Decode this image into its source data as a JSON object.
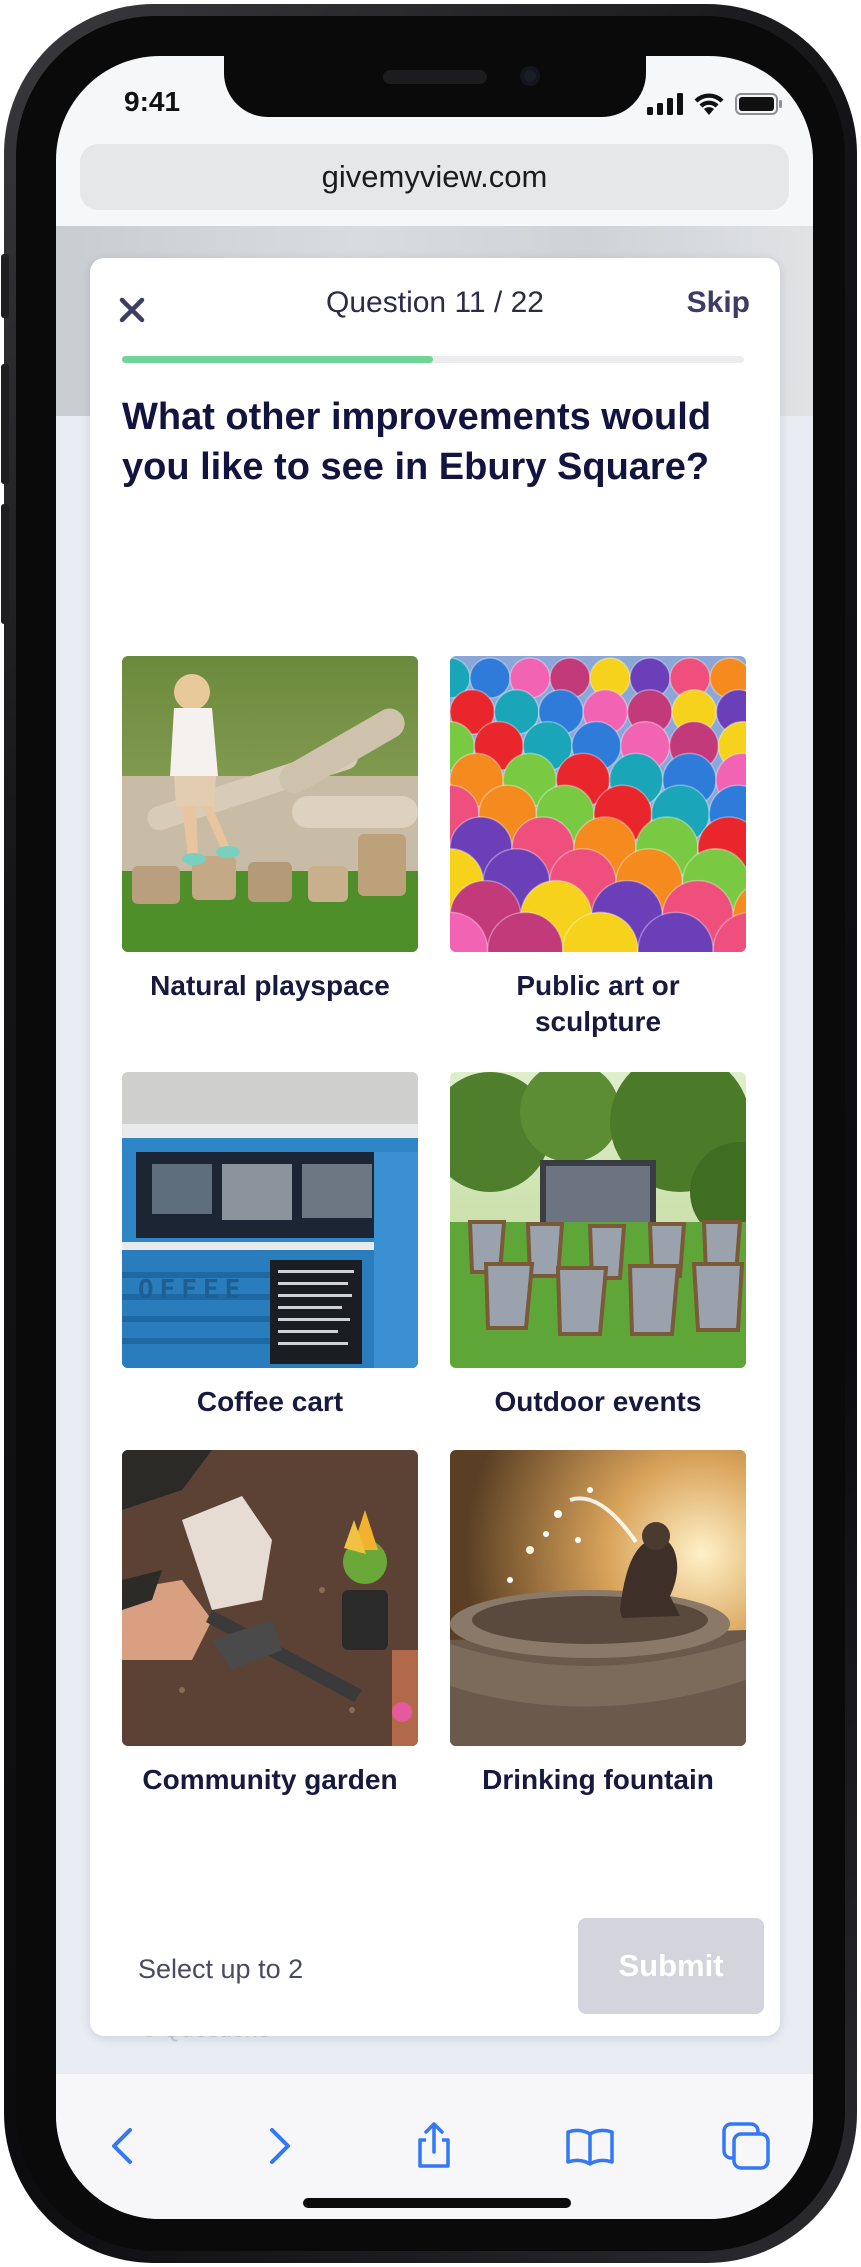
{
  "status_bar": {
    "time": "9:41"
  },
  "browser": {
    "url": "givemyview.com"
  },
  "survey": {
    "question_counter": "Question 11 / 22",
    "skip_label": "Skip",
    "progress": 0.5,
    "question": "What other improvements would you like to see in Ebury Square?",
    "options": [
      {
        "label": "Natural playspace"
      },
      {
        "label": "Public art or sculpture"
      },
      {
        "label": "Coffee cart"
      },
      {
        "label": "Outdoor events"
      },
      {
        "label": "Community garden"
      },
      {
        "label": "Drinking fountain"
      }
    ],
    "selection_hint": "Select up to 2",
    "submit_label": "Submit"
  },
  "background": {
    "faded_text": "8 Questions"
  },
  "colors": {
    "progress_fill": "#6fd49a",
    "heading": "#12143f",
    "submit_disabled": "#d4d5dc",
    "toolbar_accent": "#3478f6"
  },
  "icons": {
    "close": "close-icon",
    "back": "chevron-left-icon",
    "forward": "chevron-right-icon",
    "share": "share-icon",
    "bookmarks": "book-icon",
    "tabs": "tabs-icon"
  }
}
